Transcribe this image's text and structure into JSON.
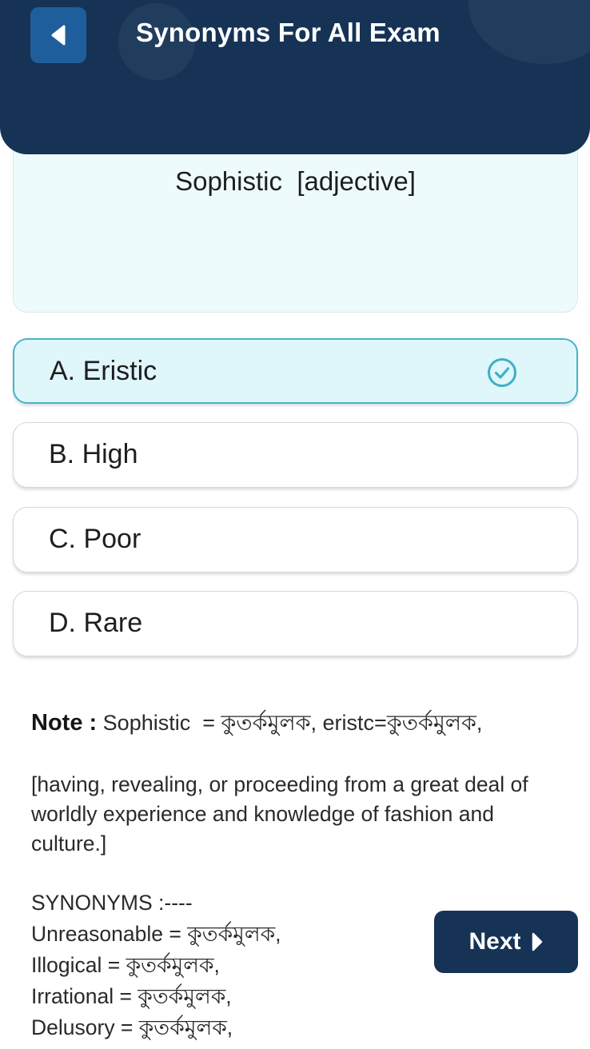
{
  "header": {
    "title": "Synonyms For All Exam",
    "back_icon": "caret-left-icon"
  },
  "question": {
    "text": "Sophistic  [adjective]"
  },
  "options": [
    {
      "label": "A. Eristic",
      "selected": true
    },
    {
      "label": "B. High",
      "selected": false
    },
    {
      "label": "C. Poor",
      "selected": false
    },
    {
      "label": "D. Rare",
      "selected": false
    }
  ],
  "note": {
    "heading": "Note :",
    "first_line": " Sophistic  = কুতর্কমুলক, eristc=কুতর্কমুলক,",
    "paragraph": "[having, revealing, or proceeding from a great deal of worldly experience and knowledge of fashion and culture.]",
    "synonyms_heading": "SYNONYMS :----",
    "synonyms": [
      "Unreasonable = কুতর্কমুলক,",
      "Illogical = কুতর্কমুলক,",
      "Irrational = কুতর্কমুলক,",
      "Delusory = কুতর্কমুলক,"
    ]
  },
  "next_button": {
    "label": "Next",
    "icon": "caret-right-icon"
  },
  "colors": {
    "header_bg": "#163356",
    "back_button_bg": "#1f5e9c",
    "question_card_bg": "#eefbfc",
    "selected_option_bg": "#dff6fb",
    "selected_border": "#49b3c8",
    "check_icon": "#3db0c4"
  }
}
